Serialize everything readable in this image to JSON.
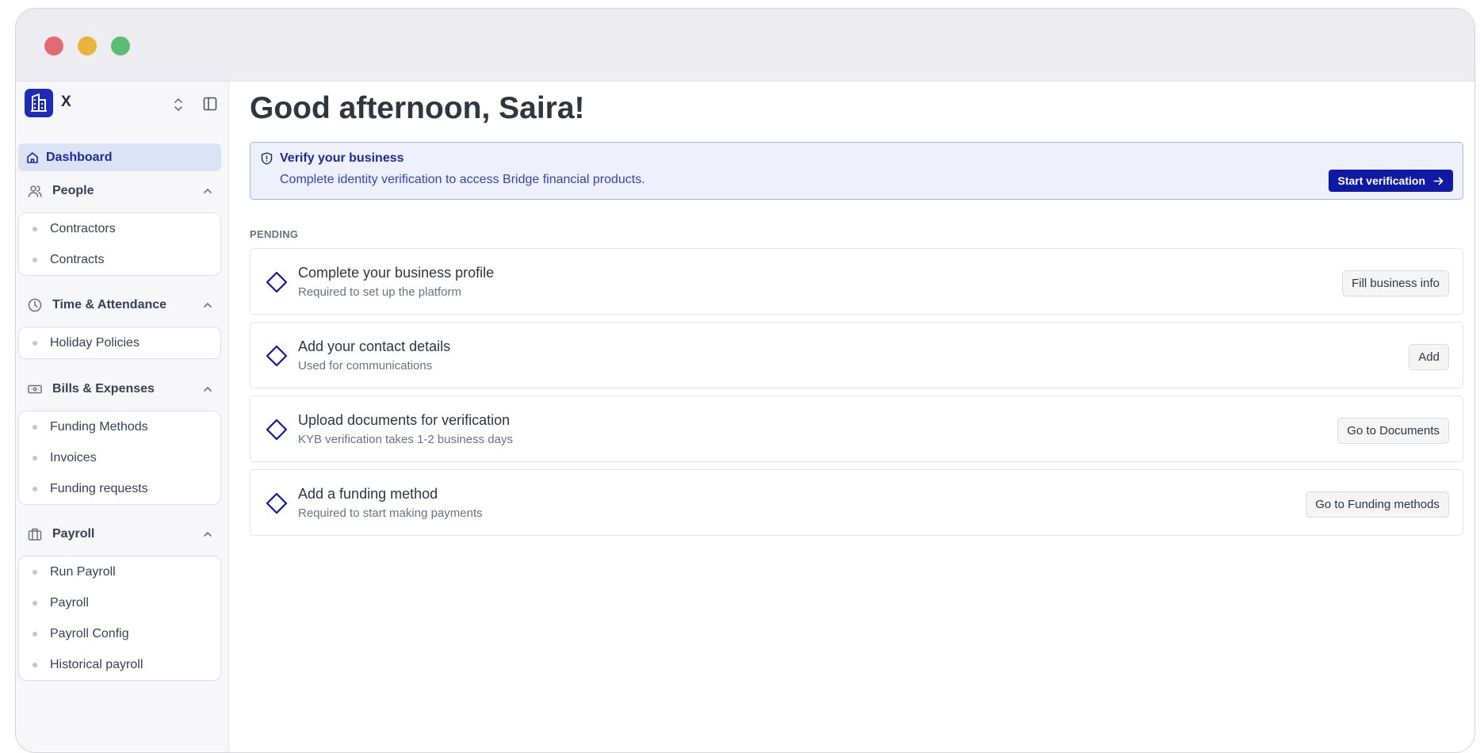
{
  "brand": {
    "name": "X",
    "logo_icon": "building-icon"
  },
  "sidebar": {
    "active": {
      "label": "Dashboard",
      "icon": "home-icon"
    },
    "sections": [
      {
        "label": "People",
        "icon": "users-icon",
        "items": [
          "Contractors",
          "Contracts"
        ]
      },
      {
        "label": "Time & Attendance",
        "icon": "clock-icon",
        "items": [
          "Holiday Policies"
        ]
      },
      {
        "label": "Bills & Expenses",
        "icon": "banknote-icon",
        "items": [
          "Funding Methods",
          "Invoices",
          "Funding requests"
        ]
      },
      {
        "label": "Payroll",
        "icon": "briefcase-icon",
        "items": [
          "Run Payroll",
          "Payroll",
          "Payroll Config",
          "Historical payroll"
        ]
      }
    ]
  },
  "main": {
    "greeting": "Good afternoon, Saira!",
    "verify_banner": {
      "title": "Verify your business",
      "description": "Complete identity verification to access Bridge financial products.",
      "button": "Start verification"
    },
    "pending_label": "PENDING",
    "tasks": [
      {
        "title": "Complete your business profile",
        "subtitle": "Required to set up the platform",
        "action": "Fill business info"
      },
      {
        "title": "Add your contact details",
        "subtitle": "Used for communications",
        "action": "Add"
      },
      {
        "title": "Upload documents for verification",
        "subtitle": "KYB verification takes 1-2 business days",
        "action": "Go to Documents"
      },
      {
        "title": "Add a funding method",
        "subtitle": "Required to start making payments",
        "action": "Go to Funding methods"
      }
    ]
  },
  "colors": {
    "accent": "#1019a6",
    "active_nav_bg": "#dde3f7",
    "banner_bg": "#eef0fb"
  }
}
